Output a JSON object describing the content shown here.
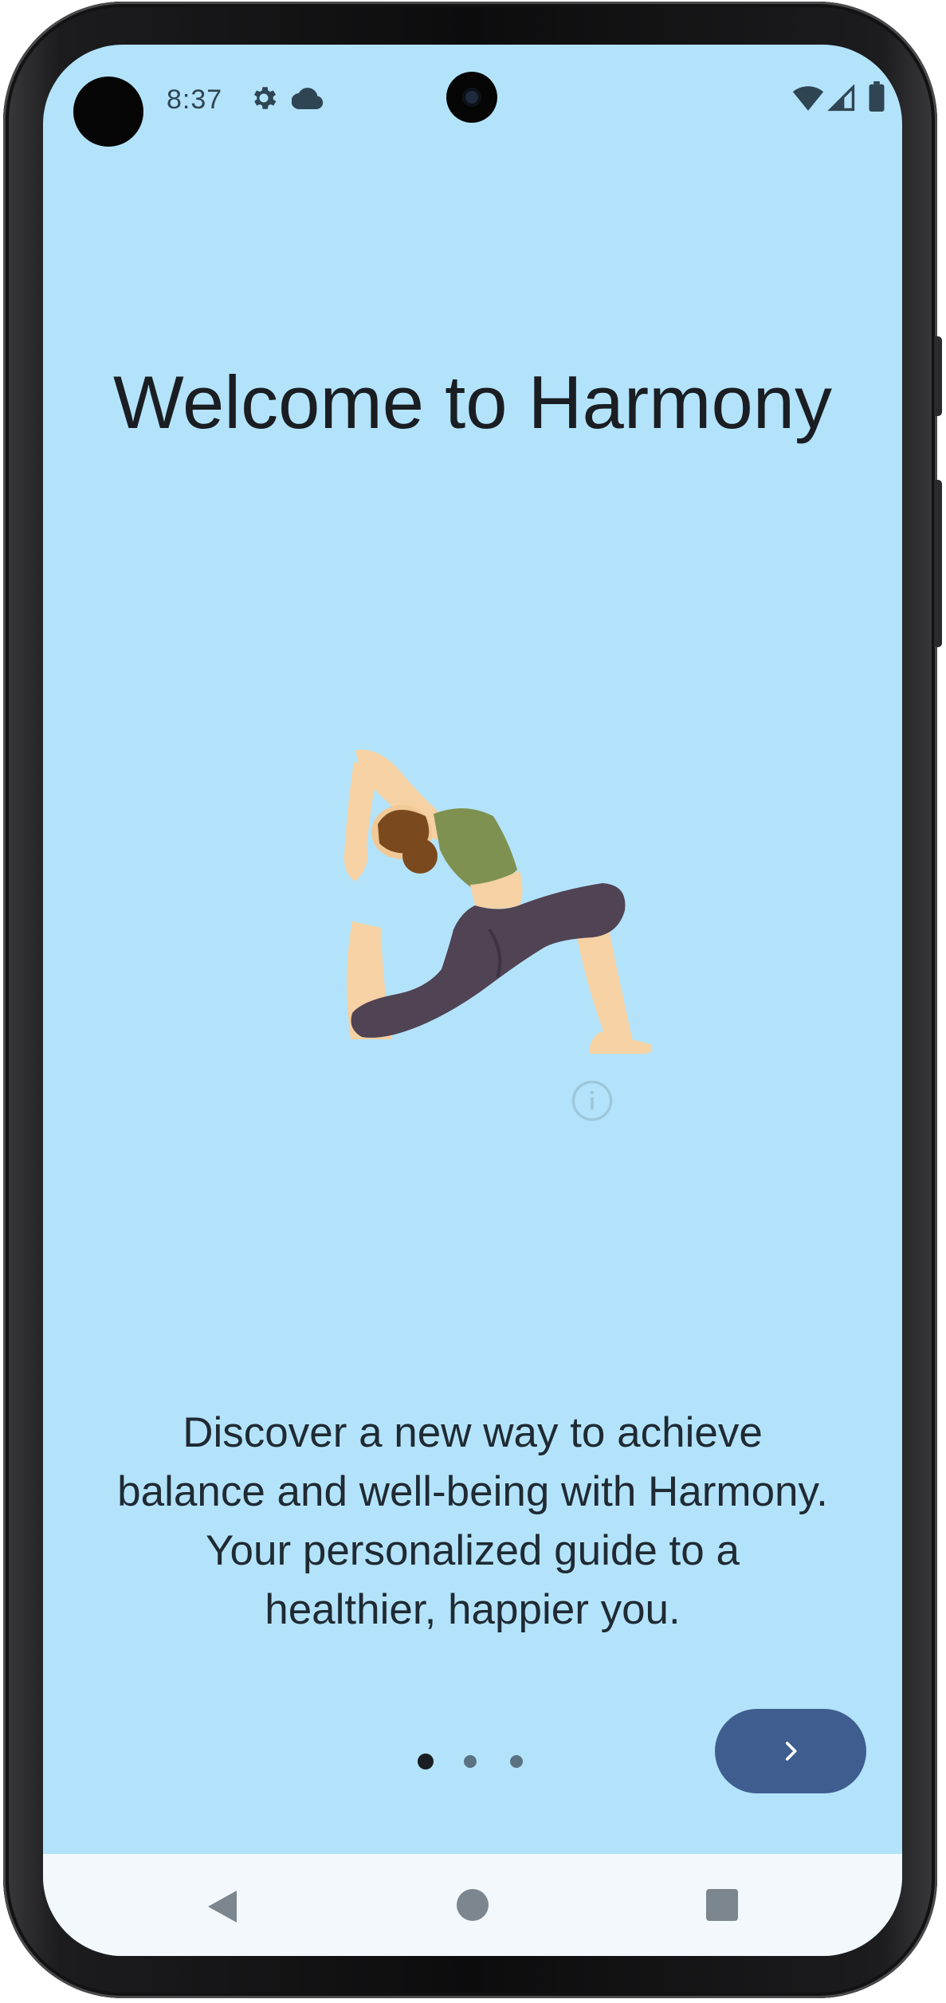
{
  "status_bar": {
    "time": "8:37",
    "icons": [
      "settings-icon",
      "cloud-icon",
      "wifi-icon",
      "signal-icon",
      "battery-icon"
    ]
  },
  "onboarding": {
    "title": "Welcome to Harmony",
    "description": "Discover a new way to achieve balance and well-being with Harmony. Your personalized guide to a healthier, happier you.",
    "page_indicator": {
      "total": 3,
      "current": 1
    },
    "next_button_icon": "chevron-right-icon"
  },
  "navigation_bar": {
    "buttons": [
      "back-icon",
      "home-icon",
      "recents-icon"
    ]
  },
  "colors": {
    "screen_background": "#b3e3fa",
    "title_text": "#1a1e22",
    "next_button": "#3f5e8f",
    "dot_active": "#1a1e22",
    "dot_inactive": "#5a7282",
    "nav_bar": "#f2f8fc"
  }
}
